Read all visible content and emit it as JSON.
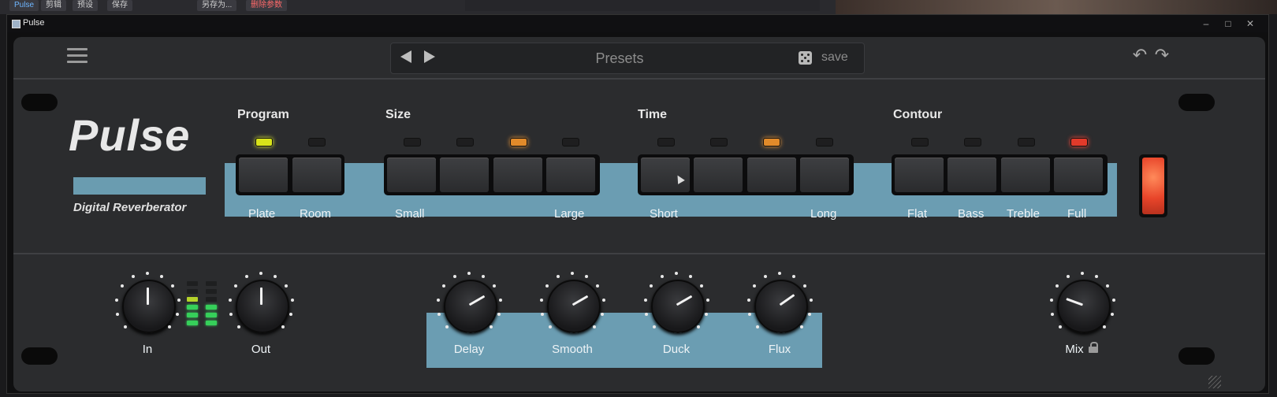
{
  "host": {
    "tabs": [
      "Pulse",
      "剪辑",
      "预设",
      "保存",
      "另存为...",
      "删除参数"
    ]
  },
  "window": {
    "title": "Pulse",
    "minimize": "–",
    "maximize": "□",
    "close": "✕"
  },
  "toolbar": {
    "preset_label": "Presets",
    "save_label": "save"
  },
  "logo": {
    "title": "Pulse",
    "subtitle": "Digital Reverberator"
  },
  "groups": {
    "program": {
      "title": "Program",
      "labels": [
        "Plate",
        "Room"
      ],
      "active_index": 0,
      "led_color": "#d8e31a"
    },
    "size": {
      "title": "Size",
      "labels": [
        "Small",
        "Large"
      ],
      "active_index": 2,
      "led_color": "#e18a2a"
    },
    "time": {
      "title": "Time",
      "labels": [
        "Short",
        "Long"
      ],
      "active_index": 2,
      "led_color": "#e18a2a"
    },
    "contour": {
      "title": "Contour",
      "labels": [
        "Flat",
        "Bass",
        "Treble",
        "Full"
      ],
      "active_index": 3,
      "led_color": "#e23a2a"
    }
  },
  "knobs": {
    "in": "In",
    "out": "Out",
    "delay": "Delay",
    "smooth": "Smooth",
    "duck": "Duck",
    "flux": "Flux",
    "mix": "Mix"
  },
  "colors": {
    "accent_blue": "#6b9db2",
    "panel": "#2b2c2e"
  }
}
